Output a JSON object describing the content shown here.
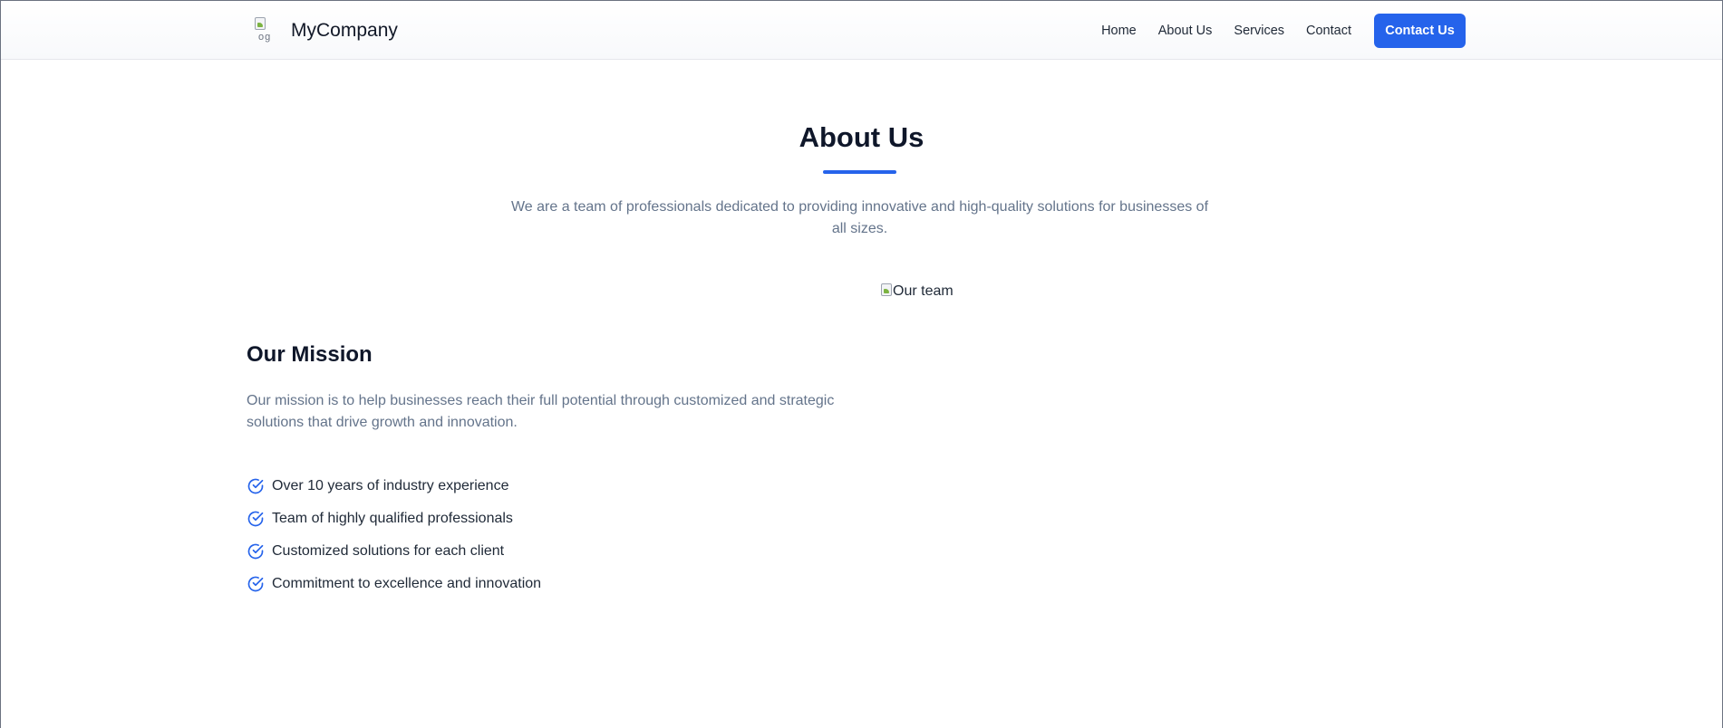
{
  "header": {
    "logo_alt": "og",
    "brand_name": "MyCompany",
    "nav": [
      "Home",
      "About Us",
      "Services",
      "Contact"
    ],
    "cta_label": "Contact Us"
  },
  "about": {
    "title": "About Us",
    "description": "We are a team of professionals dedicated to providing innovative and high-quality solutions for businesses of all sizes.",
    "team_image_alt": "Our team",
    "accent_color": "#2563eb"
  },
  "mission": {
    "title": "Our Mission",
    "text": "Our mission is to help businesses reach their full potential through customized and strategic solutions that drive growth and innovation.",
    "features": [
      "Over 10 years of industry experience",
      "Team of highly qualified professionals",
      "Customized solutions for each client",
      "Commitment to excellence and innovation"
    ],
    "feature_icon": "check-circle-icon"
  }
}
